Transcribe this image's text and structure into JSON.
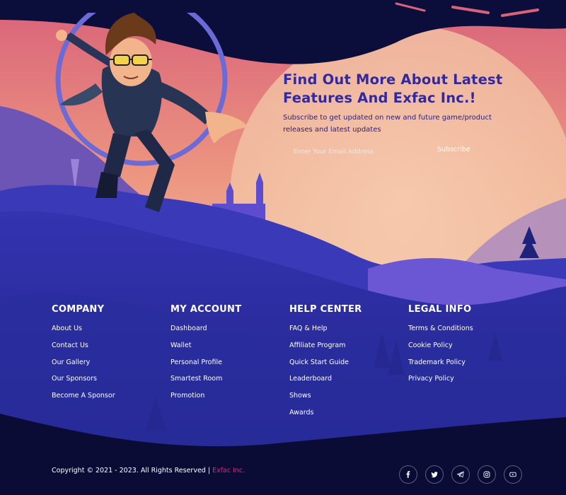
{
  "colors": {
    "brand_accent": "#e0237a",
    "headline": "#33299e",
    "footer_bg": "#0a0c35",
    "mountains": "#2b2f9e"
  },
  "newsletter": {
    "title": "Find Out More About Latest Features And Exfac Inc.!",
    "subtitle": "Subscribe to get updated on new and future game/product releases and latest updates",
    "email_placeholder": "Enter Your Email Address",
    "subscribe_label": "Subscribe"
  },
  "footer": {
    "columns": [
      {
        "heading": "COMPANY",
        "links": [
          "About Us",
          "Contact Us",
          "Our Gallery",
          "Our Sponsors",
          "Become A Sponsor"
        ]
      },
      {
        "heading": "MY ACCOUNT",
        "links": [
          "Dashboard",
          "Wallet",
          "Personal Profile",
          "Smartest Room",
          "Promotion"
        ]
      },
      {
        "heading": "HELP CENTER",
        "links": [
          "FAQ & Help",
          "Affiliate Program",
          "Quick Start Guide",
          "Leaderboard",
          "Shows",
          "Awards"
        ]
      },
      {
        "heading": "LEGAL INFO",
        "links": [
          "Terms & Conditions",
          "Cookie Policy",
          "Trademark Policy",
          "Privacy Policy"
        ]
      }
    ],
    "copyright_text": "Copyright © 2021 - 2023. All Rights Reserved |",
    "copyright_brand": "Exfac Inc.",
    "socials": [
      "facebook-icon",
      "twitter-icon",
      "telegram-icon",
      "instagram-icon",
      "youtube-icon"
    ]
  }
}
